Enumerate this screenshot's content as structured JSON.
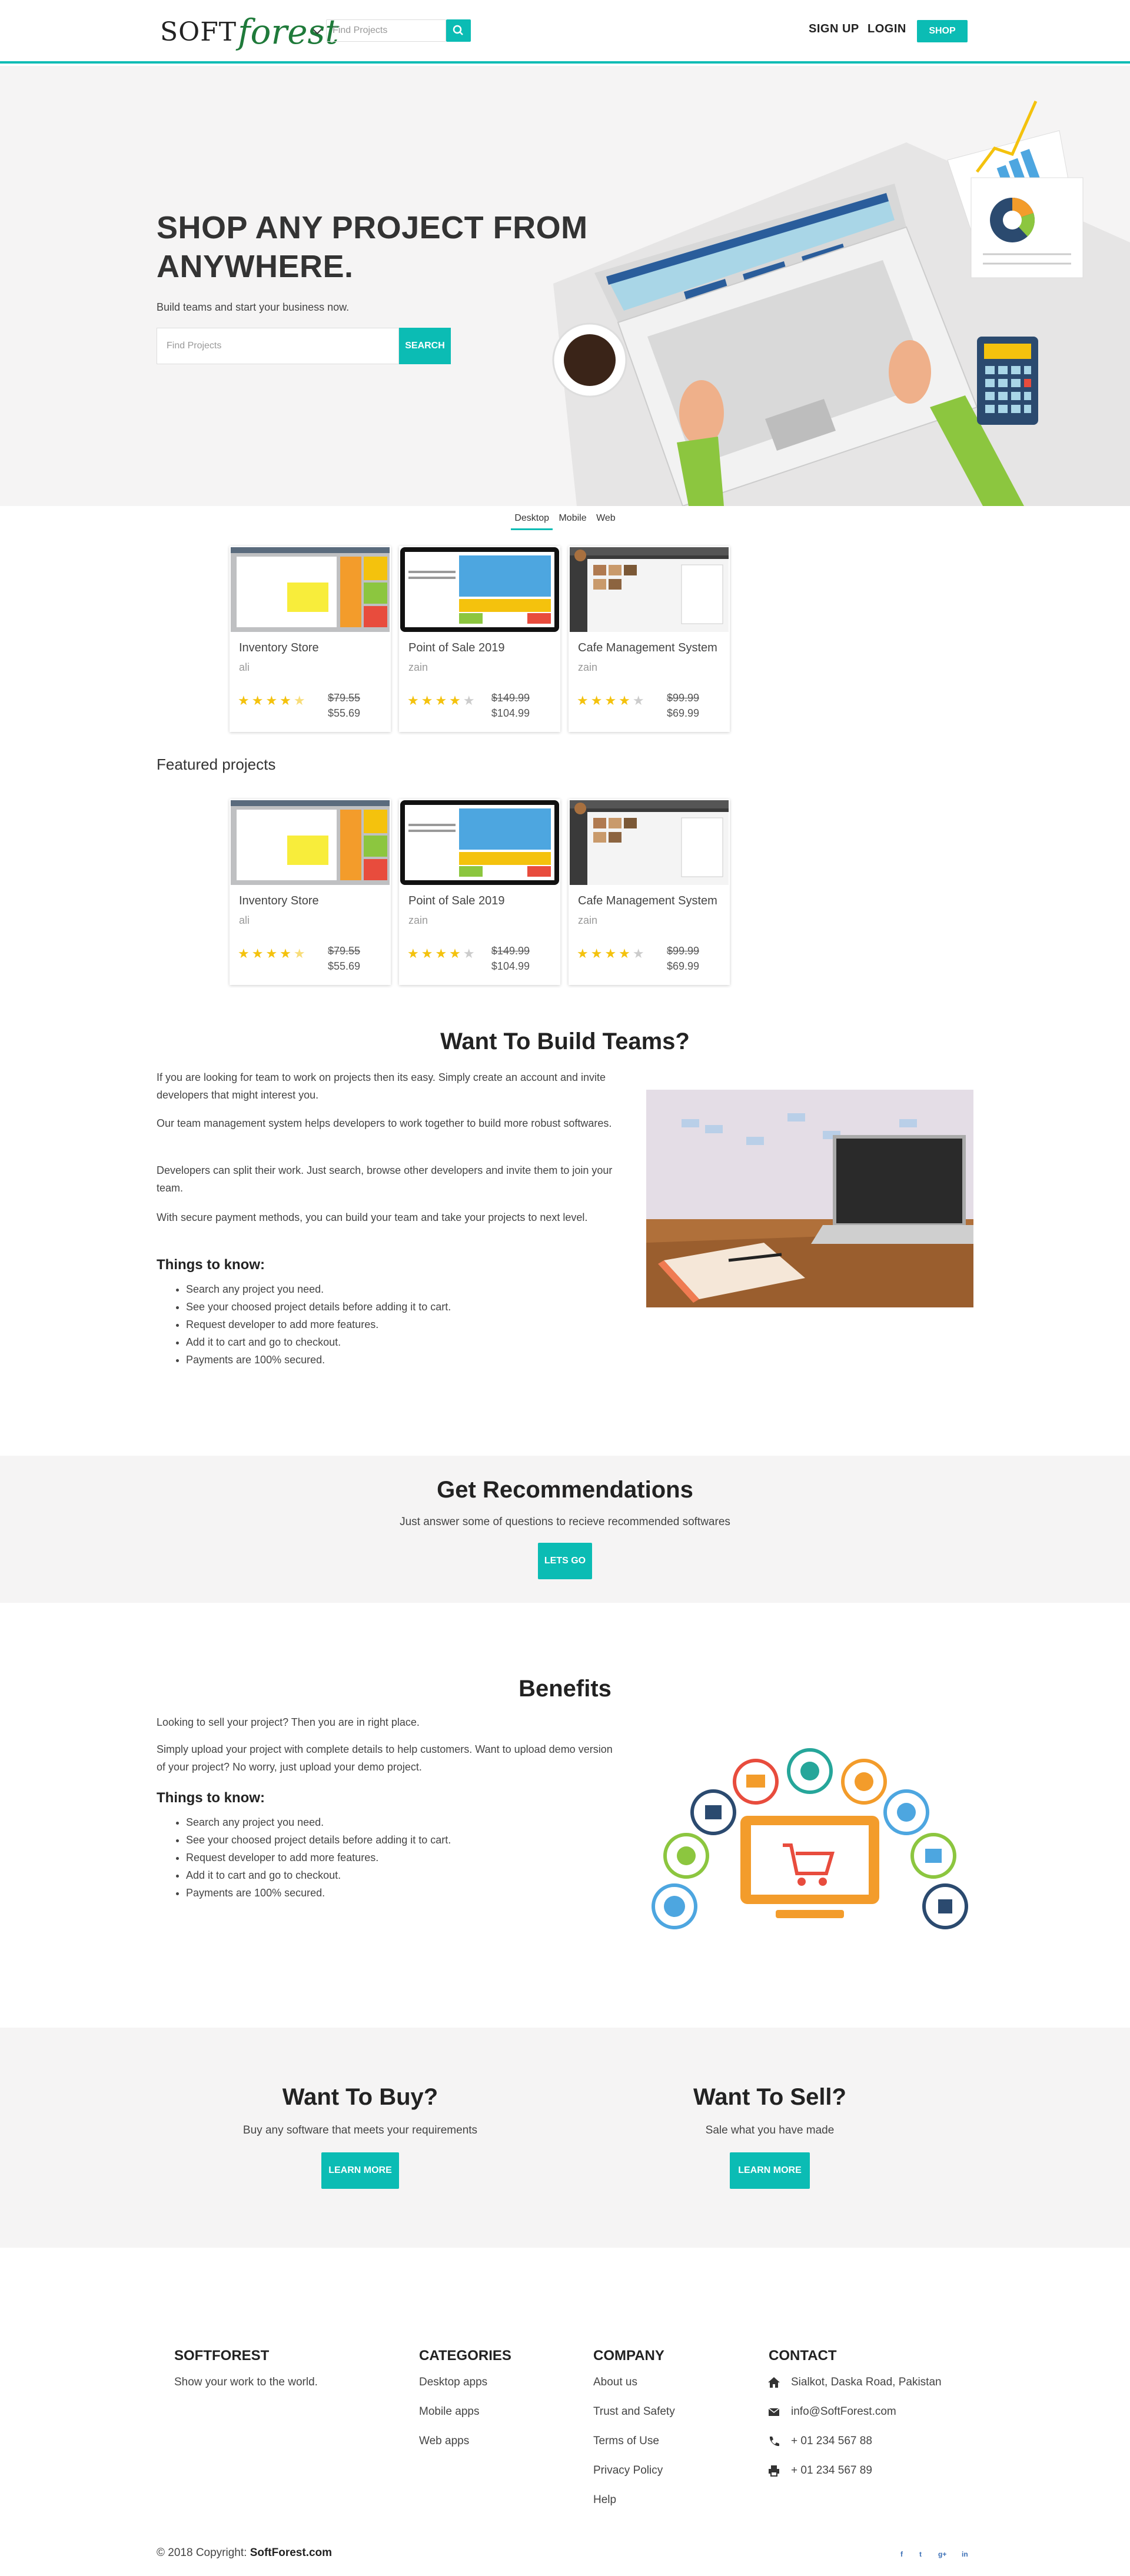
{
  "nav": {
    "logo_soft": "SOFT",
    "logo_forest": "forest",
    "search_placeholder": "Find Projects",
    "signup": "SIGN UP",
    "login": "LOGIN",
    "shop": "SHOP"
  },
  "hero": {
    "title_line1": "SHOP ANY PROJECT FROM",
    "title_line2": "ANYWHERE.",
    "subtitle": "Build teams and start your business now.",
    "search_placeholder": "Find Projects",
    "search_button": "SEARCH"
  },
  "tabs": [
    "Desktop",
    "Mobile",
    "Web"
  ],
  "products": [
    {
      "title": "Inventory Store",
      "author": "ali",
      "rating": 4.5,
      "old_price": "$79.55",
      "new_price": "$55.69"
    },
    {
      "title": "Point of Sale 2019",
      "author": "zain",
      "rating": 4,
      "old_price": "$149.99",
      "new_price": "$104.99"
    },
    {
      "title": "Cafe Management System",
      "author": "zain",
      "rating": 4,
      "old_price": "$99.99",
      "new_price": "$69.99"
    }
  ],
  "featured": {
    "title": "Featured projects",
    "items": [
      {
        "title": "Inventory Store",
        "author": "ali",
        "rating": 4.5,
        "old_price": "$79.55",
        "new_price": "$55.69"
      },
      {
        "title": "Point of Sale 2019",
        "author": "zain",
        "rating": 4,
        "old_price": "$149.99",
        "new_price": "$104.99"
      },
      {
        "title": "Cafe Management System",
        "author": "zain",
        "rating": 4,
        "old_price": "$99.99",
        "new_price": "$69.99"
      }
    ]
  },
  "teams": {
    "title": "Want To Build Teams?",
    "p1": "If you are looking for team to work on projects then its easy. Simply create an account and invite developers that might interest you.",
    "p2": "Our team management system helps developers to work together to build more robust softwares.",
    "p3": "Developers can split their work. Just search, browse other developers and invite them to join your team.",
    "p4": "With secure payment methods, you can build your team and take your projects to next level.",
    "things_title": "Things to know:",
    "things": [
      "Search any project you need.",
      "See your choosed project details before adding it to cart.",
      "Request developer to add more features.",
      "Add it to cart and go to checkout.",
      "Payments are 100% secured."
    ]
  },
  "recommend": {
    "title": "Get Recommendations",
    "text": "Just answer some of questions to recieve recommended softwares",
    "button": "LETS GO"
  },
  "benefits": {
    "title": "Benefits",
    "p1": "Looking to sell your project? Then you are in right place.",
    "p2": "Simply upload your project with complete details to help customers. Want to upload demo version of your project? No worry, just upload your demo project.",
    "things_title": "Things to know:",
    "things": [
      "Search any project you need.",
      "See your choosed project details before adding it to cart.",
      "Request developer to add more features.",
      "Add it to cart and go to checkout.",
      "Payments are 100% secured."
    ]
  },
  "buy": {
    "title": "Want To Buy?",
    "text": "Buy any software that meets your requirements",
    "button": "LEARN MORE"
  },
  "sell": {
    "title": "Want To Sell?",
    "text": "Sale what you have made",
    "button": "LEARN MORE"
  },
  "footer": {
    "brand_title": "SOFTFOREST",
    "brand_text": "Show your work to the world.",
    "categories_title": "CATEGORIES",
    "categories": [
      "Desktop apps",
      "Mobile apps",
      "Web apps"
    ],
    "company_title": "COMPANY",
    "company": [
      "About us",
      "Trust and Safety",
      "Terms of Use",
      "Privacy Policy",
      "Help"
    ],
    "contact_title": "CONTACT",
    "address": "Sialkot, Daska Road, Pakistan",
    "email": "info@SoftForest.com",
    "phone": "+ 01 234 567 88",
    "fax": "+ 01 234 567 89",
    "copyright_prefix": "© 2018 Copyright:",
    "copyright_site": "SoftForest.com",
    "social": [
      "f",
      "t",
      "g+",
      "in"
    ]
  },
  "colors": {
    "accent": "#0bbcb4",
    "band": "#f5f4f4",
    "star": "#f4c20d"
  }
}
